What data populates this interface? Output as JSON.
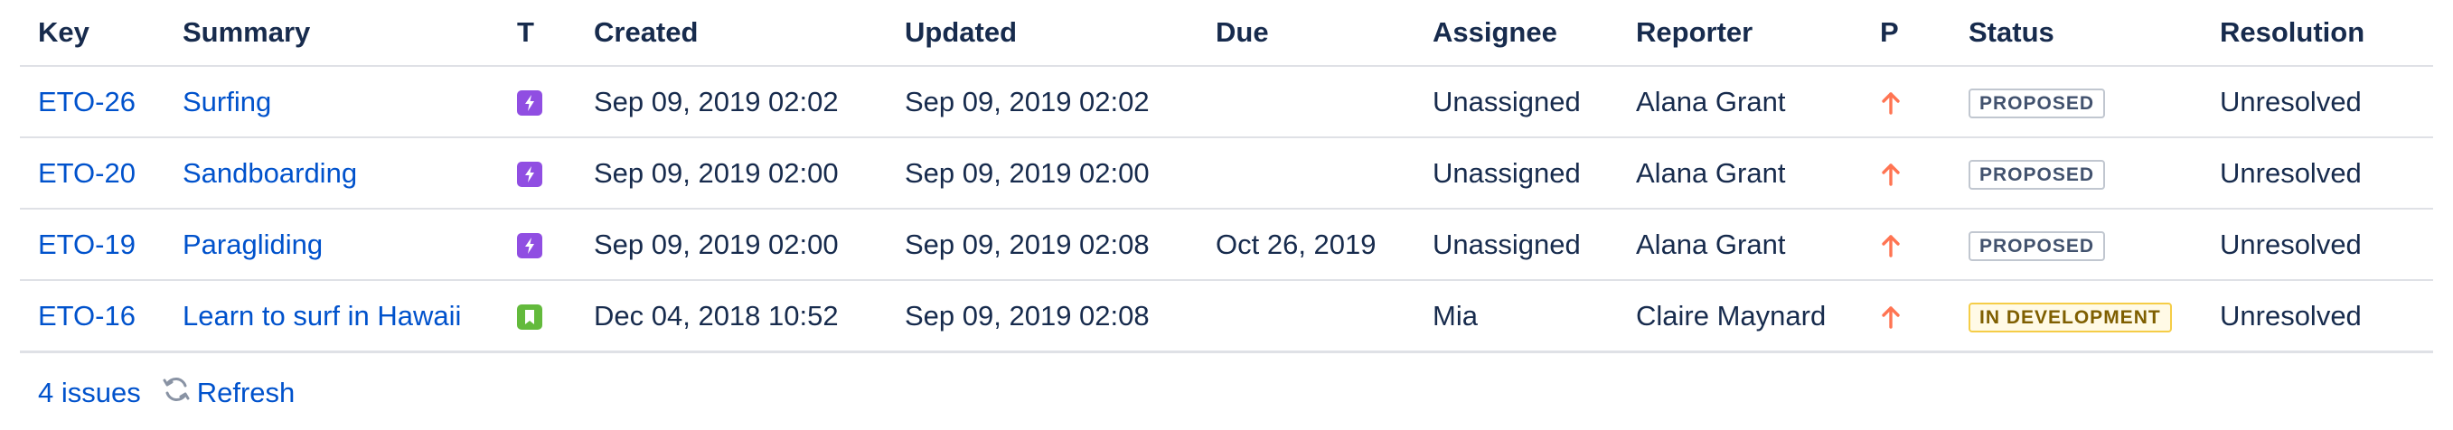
{
  "columns": {
    "key": "Key",
    "summary": "Summary",
    "type": "T",
    "created": "Created",
    "updated": "Updated",
    "due": "Due",
    "assignee": "Assignee",
    "reporter": "Reporter",
    "priority": "P",
    "status": "Status",
    "resolution": "Resolution"
  },
  "rows": [
    {
      "key": "ETO-26",
      "summary": "Surfing",
      "type_icon": "epic-lightning-icon",
      "created": "Sep 09, 2019 02:02",
      "updated": "Sep 09, 2019 02:02",
      "due": "",
      "assignee": "Unassigned",
      "reporter": "Alana Grant",
      "priority_icon": "priority-arrow-up-icon",
      "status": "PROPOSED",
      "resolution": "Unresolved"
    },
    {
      "key": "ETO-20",
      "summary": "Sandboarding",
      "type_icon": "epic-lightning-icon",
      "created": "Sep 09, 2019 02:00",
      "updated": "Sep 09, 2019 02:00",
      "due": "",
      "assignee": "Unassigned",
      "reporter": "Alana Grant",
      "priority_icon": "priority-arrow-up-icon",
      "status": "PROPOSED",
      "resolution": "Unresolved"
    },
    {
      "key": "ETO-19",
      "summary": "Paragliding",
      "type_icon": "epic-lightning-icon",
      "created": "Sep 09, 2019 02:00",
      "updated": "Sep 09, 2019 02:08",
      "due": "Oct 26, 2019",
      "assignee": "Unassigned",
      "reporter": "Alana Grant",
      "priority_icon": "priority-arrow-up-icon",
      "status": "PROPOSED",
      "resolution": "Unresolved"
    },
    {
      "key": "ETO-16",
      "summary": "Learn to surf in Hawaii",
      "type_icon": "story-bookmark-icon",
      "created": "Dec 04, 2018 10:52",
      "updated": "Sep 09, 2019 02:08",
      "due": "",
      "assignee": "Mia",
      "reporter": "Claire Maynard",
      "priority_icon": "priority-arrow-up-icon",
      "status": "IN DEVELOPMENT",
      "resolution": "Unresolved"
    }
  ],
  "footer": {
    "count": "4 issues",
    "refresh": "Refresh"
  },
  "colors": {
    "link": "#0052cc",
    "epic": "#904ee2",
    "story": "#63ba3c",
    "priority_high": "#ff7452",
    "lozenge_proposed_bg": "#ffffff",
    "lozenge_proposed_border": "#c1c7d0",
    "lozenge_proposed_text": "#42526e",
    "lozenge_dev_border": "#f5cd47",
    "lozenge_dev_text": "#7f5f01"
  }
}
